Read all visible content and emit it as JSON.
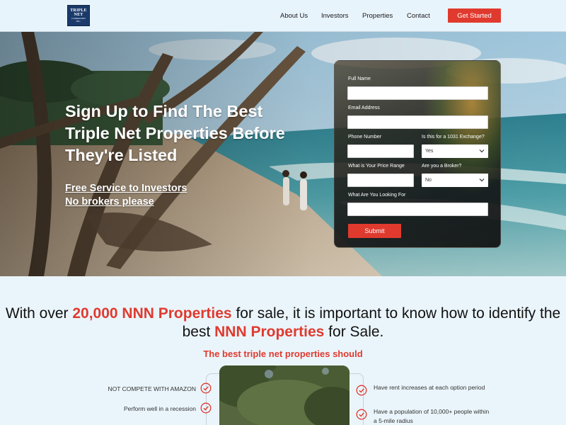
{
  "header": {
    "logo": {
      "line1": "TRIPLE",
      "line2": "NET",
      "line3": "COMPANIES",
      "line4": "INC."
    },
    "nav": [
      {
        "label": "About Us"
      },
      {
        "label": "Investors"
      },
      {
        "label": "Properties"
      },
      {
        "label": "Contact"
      }
    ],
    "cta_label": "Get Started"
  },
  "hero": {
    "title": "Sign Up to Find The Best Triple Net Properties Before They're Listed",
    "sub1": "Free Service to Investors",
    "sub2": "No brokers please"
  },
  "form": {
    "full_name_label": "Full Name",
    "email_label": "Email Address",
    "phone_label": "Phone Number",
    "exchange_label": "Is this for a 1031 Exchange?",
    "exchange_value": "Yes",
    "price_label": "What is Your Price Range",
    "broker_label": "Are you a Broker?",
    "broker_value": "No",
    "looking_label": "What Are You Looking For",
    "submit_label": "Submit"
  },
  "section": {
    "headline_p1": "With over ",
    "headline_red1": "20,000 NNN Properties",
    "headline_p2": " for sale, it is important to know how to identify the best ",
    "headline_red2": "NNN Properties",
    "headline_p3": " for Sale.",
    "subhead": "The best triple net properties should",
    "left_items": [
      "NOT COMPETE WITH AMAZON",
      "Perform well in a recession"
    ],
    "right_items": [
      "Have rent increases at each option period",
      "Have a population of 10,000+ people within a 5-mile radius"
    ]
  },
  "colors": {
    "accent": "#e03a2f",
    "page_bg": "#eaf5fb",
    "logo_navy": "#1b3a6b"
  }
}
